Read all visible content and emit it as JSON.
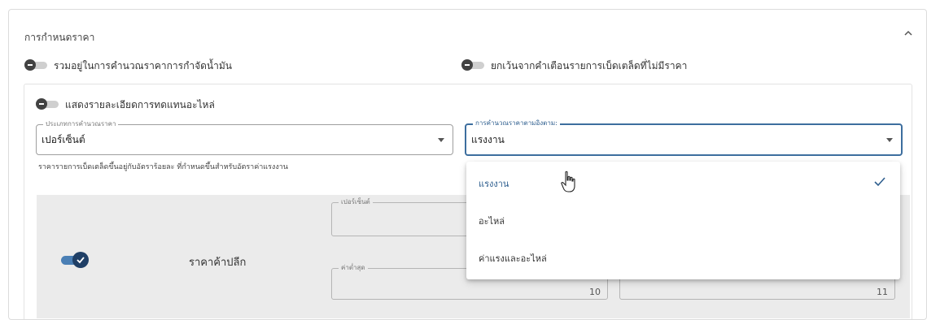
{
  "section": {
    "title": "การกำหนดราคา",
    "collapse_icon": "chevron-up-icon"
  },
  "toggles": {
    "include_oil_disposal": {
      "label": "รวมอยู่ในการคำนวณราคาการกำจัดน้ำมัน",
      "on": false
    },
    "exclude_unpriced_warning": {
      "label": "ยกเว้นจากคำเตือนรายการเบ็ดเตล็ดที่ไม่มีราคา",
      "on": false
    },
    "show_part_substitution": {
      "label": "แสดงรายละเอียดการทดแทนอะไหล่",
      "on": false
    }
  },
  "pricing_type": {
    "label": "ประเภทการคำนวณราคา",
    "value": "เปอร์เซ็นต์"
  },
  "price_based_on": {
    "label": "การคำนวณราคาตามอิงตาม:",
    "value": "แรงงาน",
    "options": [
      {
        "label": "แรงงาน",
        "selected": true
      },
      {
        "label": "อะไหล่",
        "selected": false
      },
      {
        "label": "ค่าแรงและอะไหล่",
        "selected": false
      }
    ]
  },
  "helper_text": "ราคารายการเบ็ดเตล็ดขึ้นอยู่กับอัตราร้อยละ ที่กำหนดขึ้นสำหรับอัตราค่าแรงงาน",
  "retail_row": {
    "label": "ราคาค้าปลีก",
    "enabled": true,
    "percent_label": "เปอร์เซ็นต์",
    "min_label": "ค่าต่ำสุด",
    "min_value": "10",
    "max_value": "11"
  },
  "colors": {
    "accent": "#2f5f8f",
    "toggle_on": "#1f3f66",
    "panel_bg": "#ebebeb"
  }
}
